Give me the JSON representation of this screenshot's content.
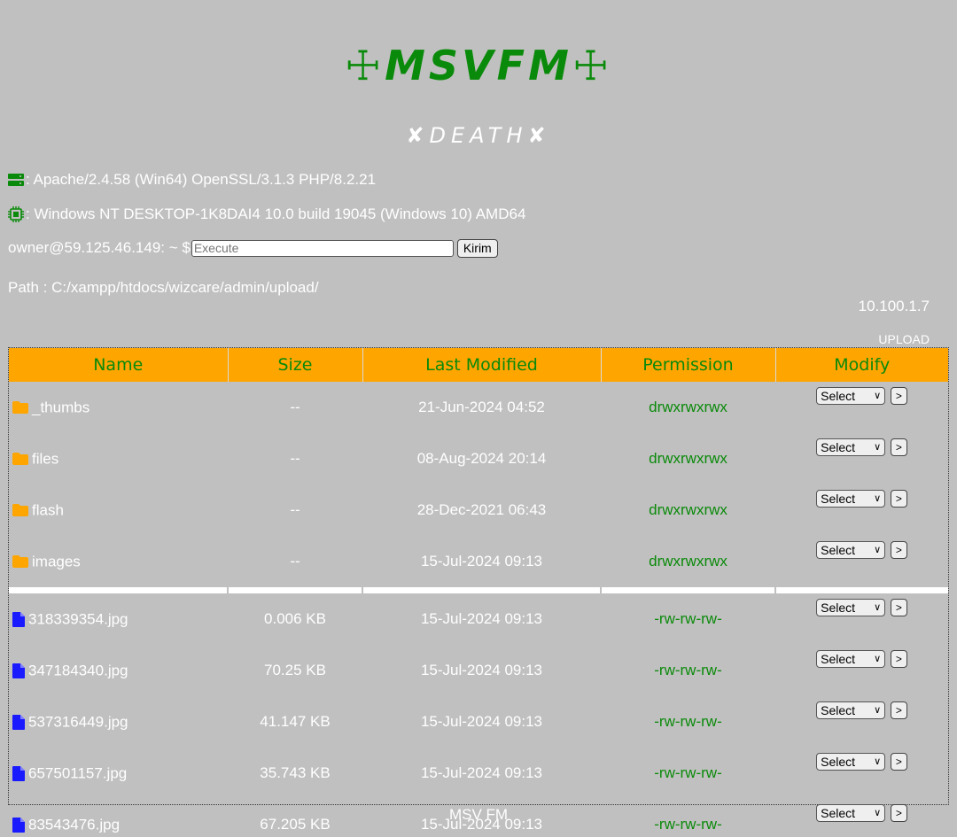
{
  "logo": {
    "cross_left": "☩",
    "text": "MSVFM",
    "cross_right": "☩"
  },
  "subtitle": {
    "left_mark": "✘",
    "text": "DEATH",
    "right_mark": "✘"
  },
  "server_info": {
    "server_icon": "server-icon",
    "server_text": ": Apache/2.4.58 (Win64) OpenSSL/3.1.3 PHP/8.2.21",
    "os_icon": "cpu-chip-icon",
    "os_text": ": Windows NT DESKTOP-1K8DAI4 10.0 build 19045 (Windows 10) AMD64"
  },
  "command": {
    "prompt": "owner@59.125.46.149: ~ $",
    "placeholder": "Execute",
    "button_label": "Kirim"
  },
  "path": "Path : C:/xampp/htdocs/wizcare/admin/upload/",
  "ip": "10.100.1.7",
  "upload_label": "UPLOAD",
  "table": {
    "headers": [
      "Name",
      "Size",
      "Last Modified",
      "Permission",
      "Modify"
    ],
    "select_label": "Select",
    "go_label": ">",
    "directories": [
      {
        "name": "_thumbs",
        "size": "--",
        "modified": "21-Jun-2024 04:52",
        "perm": "drwxrwxrwx"
      },
      {
        "name": "files",
        "size": "--",
        "modified": "08-Aug-2024 20:14",
        "perm": "drwxrwxrwx"
      },
      {
        "name": "flash",
        "size": "--",
        "modified": "28-Dec-2021 06:43",
        "perm": "drwxrwxrwx"
      },
      {
        "name": "images",
        "size": "--",
        "modified": "15-Jul-2024 09:13",
        "perm": "drwxrwxrwx"
      }
    ],
    "files": [
      {
        "name": "318339354.jpg",
        "size": "0.006 KB",
        "modified": "15-Jul-2024 09:13",
        "perm": "-rw-rw-rw-"
      },
      {
        "name": "347184340.jpg",
        "size": "70.25 KB",
        "modified": "15-Jul-2024 09:13",
        "perm": "-rw-rw-rw-"
      },
      {
        "name": "537316449.jpg",
        "size": "41.147 KB",
        "modified": "15-Jul-2024 09:13",
        "perm": "-rw-rw-rw-"
      },
      {
        "name": "657501157.jpg",
        "size": "35.743 KB",
        "modified": "15-Jul-2024 09:13",
        "perm": "-rw-rw-rw-"
      },
      {
        "name": "83543476.jpg",
        "size": "67.205 KB",
        "modified": "15-Jul-2024 09:13",
        "perm": "-rw-rw-rw-"
      }
    ]
  },
  "footer": "MSV FM",
  "colors": {
    "background": "#c0c0c0",
    "header_bg": "#ffa500",
    "accent_green": "#0a8a0a",
    "folder": "#ffa500",
    "file": "#1a1aff"
  }
}
